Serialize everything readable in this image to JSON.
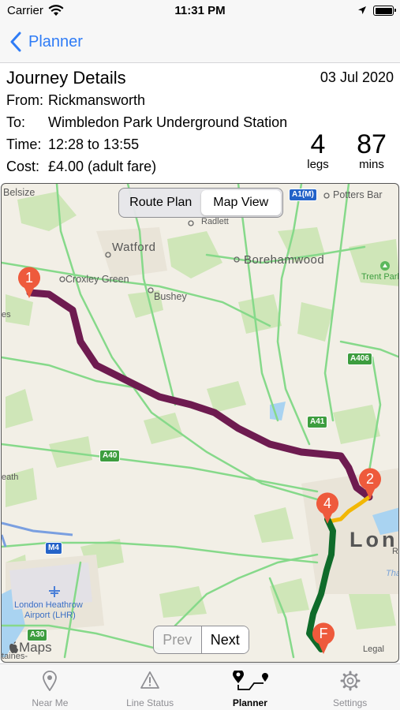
{
  "status_bar": {
    "carrier": "Carrier",
    "time": "11:31 PM"
  },
  "nav": {
    "back_label": "Planner"
  },
  "details": {
    "title": "Journey Details",
    "date": "03 Jul 2020",
    "from_label": "From:",
    "from_value": "Rickmansworth",
    "to_label": "To:",
    "to_value": "Wimbledon Park Underground Station",
    "time_label": "Time:",
    "time_value": "12:28 to 13:55",
    "cost_label": "Cost:",
    "cost_value": "£4.00 (adult fare)",
    "legs_value": "4",
    "legs_unit": "legs",
    "mins_value": "87",
    "mins_unit": "mins"
  },
  "map": {
    "segments": {
      "route_plan": "Route Plan",
      "map_view": "Map View",
      "selected": "Map View"
    },
    "pager": {
      "prev": "Prev",
      "next": "Next"
    },
    "places": {
      "belsize": "Belsize",
      "potters_bar": "Potters Bar",
      "radlett": "Radlett",
      "watford": "Watford",
      "borehamwood": "Borehamwood",
      "croxley_green": "Croxley Green",
      "trent_park": "Trent Park",
      "bushey": "Bushey",
      "es": "es",
      "eath": "eath",
      "london": "Lon",
      "heathrow_1": "London Heathrow",
      "heathrow_2": "Airport (LHR)",
      "taines": "taines-",
      "tha": "Tha",
      "r_suffix": "R"
    },
    "roads": {
      "a1m": "A1(M)",
      "a406": "A406",
      "a41": "A41",
      "a40": "A40",
      "m4": "M4",
      "a30": "A30"
    },
    "pins": [
      "1",
      "2",
      "4",
      "F"
    ],
    "maps_brand": "Maps",
    "legal": "Legal"
  },
  "tabs": [
    {
      "label": "Near Me",
      "icon": "location-pin-icon"
    },
    {
      "label": "Line Status",
      "icon": "warning-icon"
    },
    {
      "label": "Planner",
      "icon": "route-icon"
    },
    {
      "label": "Settings",
      "icon": "gear-icon"
    }
  ],
  "colors": {
    "accent": "#2f7cf6",
    "route_metropolitan": "#6e1b50",
    "route_district": "#0f6b2a",
    "route_connector": "#f2b705",
    "pin": "#ee5a3c"
  }
}
